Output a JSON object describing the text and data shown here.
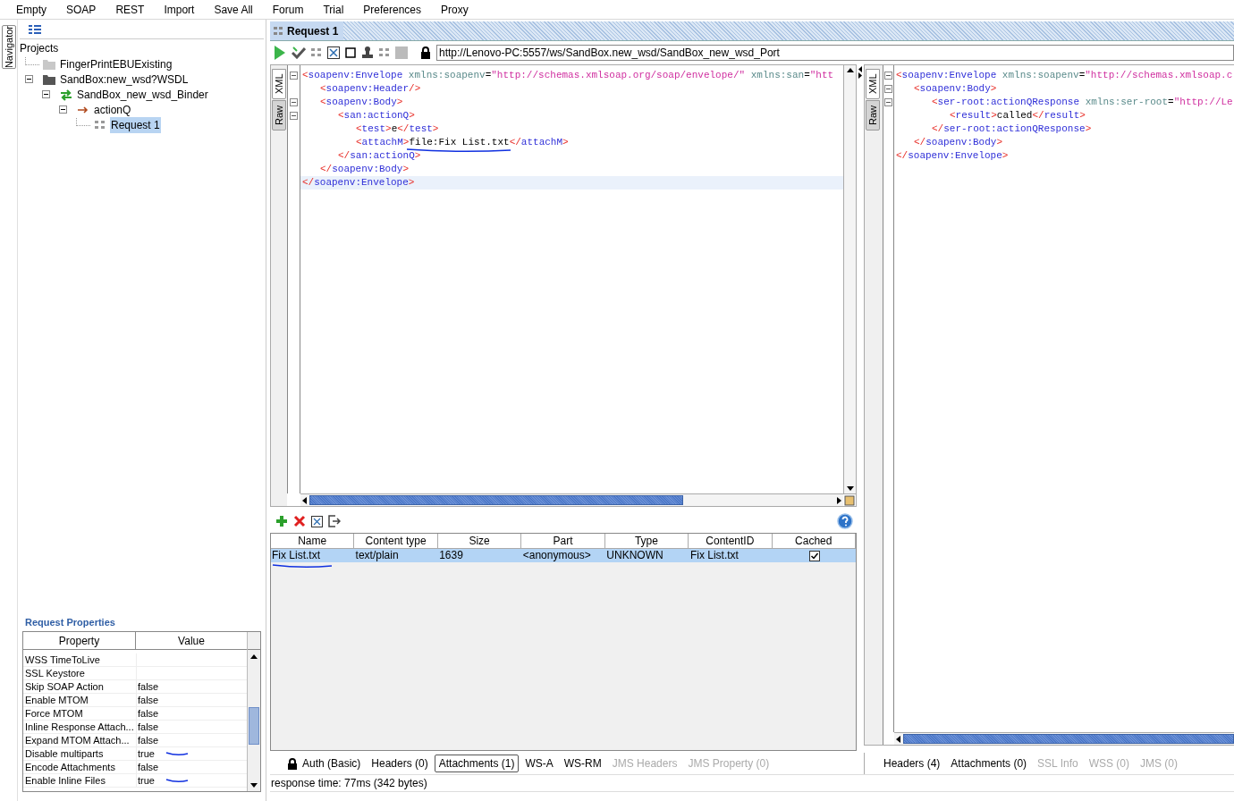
{
  "menu": [
    "Empty",
    "SOAP",
    "REST",
    "Import",
    "Save All",
    "Forum",
    "Trial",
    "Preferences",
    "Proxy"
  ],
  "navigator_tab": "Navigator",
  "tree": {
    "label": "Projects",
    "children": [
      {
        "label": "FingerPrintEBUExisting",
        "kind": "closed-project",
        "selected": false
      },
      {
        "label": "SandBox:new_wsd?WSDL",
        "kind": "project",
        "expanded": true,
        "selected": false,
        "children": [
          {
            "label": "SandBox_new_wsd_Binder",
            "kind": "interface",
            "expanded": true,
            "selected": false,
            "children": [
              {
                "label": "actionQ",
                "kind": "operation",
                "expanded": true,
                "selected": false,
                "children": [
                  {
                    "label": "Request 1",
                    "kind": "request",
                    "selected": true
                  }
                ]
              }
            ]
          }
        ]
      }
    ]
  },
  "request_properties": {
    "title": "Request Properties",
    "columns": [
      "Property",
      "Value"
    ],
    "rows": [
      {
        "property": "WSS TimeToLive",
        "pen_mark": false
      },
      {
        "property": "SSL Keystore",
        "pen_mark": false
      },
      {
        "property": "Skip SOAP Action",
        "value": "false",
        "pen_mark": false
      },
      {
        "property": "Enable MTOM",
        "value": "false",
        "pen_mark": false
      },
      {
        "property": "Force MTOM",
        "value": "false",
        "pen_mark": false
      },
      {
        "property": "Inline Response Attach...",
        "value": "false",
        "pen_mark": false
      },
      {
        "property": "Expand MTOM Attach...",
        "value": "false",
        "pen_mark": false
      },
      {
        "property": "Disable multiparts",
        "value": "true",
        "pen_mark": true
      },
      {
        "property": "Encode Attachments",
        "value": "false",
        "pen_mark": false
      },
      {
        "property": "Enable Inline Files",
        "value": "true",
        "pen_mark": true
      }
    ]
  },
  "request": {
    "title": "Request 1",
    "url": "http://Lenovo-PC:5557/ws/SandBox.new_wsd/SandBox_new_wsd_Port",
    "editor_tabs": [
      {
        "label": "XML",
        "selected": true
      },
      {
        "label": "Raw",
        "selected": false
      }
    ],
    "lines": [
      {
        "fold": true,
        "tokens": [
          {
            "kind": "punct",
            "text": "<"
          },
          {
            "kind": "tag",
            "text": "soapenv:Envelope"
          },
          {
            "kind": "attr",
            "text": " xmlns:soapenv"
          },
          {
            "kind": "text",
            "text": "="
          },
          {
            "kind": "value",
            "text": "\"http://schemas.xmlsoap.org/soap/envelope/\""
          },
          {
            "kind": "attr",
            "text": " xmlns:san"
          },
          {
            "kind": "text",
            "text": "="
          },
          {
            "kind": "value",
            "text": "\"htt"
          }
        ],
        "children": [
          {
            "fold": false,
            "tokens": [
              {
                "kind": "punct",
                "text": "<"
              },
              {
                "kind": "tag",
                "text": "soapenv:Header"
              },
              {
                "kind": "punct",
                "text": "/>"
              }
            ]
          },
          {
            "fold": true,
            "tokens": [
              {
                "kind": "punct",
                "text": "<"
              },
              {
                "kind": "tag",
                "text": "soapenv:Body"
              },
              {
                "kind": "punct",
                "text": ">"
              }
            ],
            "children": [
              {
                "fold": true,
                "tokens": [
                  {
                    "kind": "punct",
                    "text": "<"
                  },
                  {
                    "kind": "tag",
                    "text": "san:actionQ"
                  },
                  {
                    "kind": "punct",
                    "text": ">"
                  }
                ],
                "children": [
                  {
                    "fold": false,
                    "tokens": [
                      {
                        "kind": "punct",
                        "text": "<"
                      },
                      {
                        "kind": "tag",
                        "text": "test"
                      },
                      {
                        "kind": "punct",
                        "text": ">"
                      },
                      {
                        "kind": "text",
                        "text": "e"
                      },
                      {
                        "kind": "punct",
                        "text": "</"
                      },
                      {
                        "kind": "tag",
                        "text": "test"
                      },
                      {
                        "kind": "punct",
                        "text": ">"
                      }
                    ]
                  },
                  {
                    "fold": false,
                    "pen_mark": true,
                    "tokens": [
                      {
                        "kind": "punct",
                        "text": "<"
                      },
                      {
                        "kind": "tag",
                        "text": "attachM"
                      },
                      {
                        "kind": "punct",
                        "text": ">"
                      },
                      {
                        "kind": "text",
                        "text": "file:Fix List.txt"
                      },
                      {
                        "kind": "punct",
                        "text": "</"
                      },
                      {
                        "kind": "tag",
                        "text": "attachM"
                      },
                      {
                        "kind": "punct",
                        "text": ">"
                      }
                    ]
                  }
                ]
              },
              {
                "fold": false,
                "tokens": [
                  {
                    "kind": "punct",
                    "text": "</"
                  },
                  {
                    "kind": "tag",
                    "text": "san:actionQ"
                  },
                  {
                    "kind": "punct",
                    "text": ">"
                  }
                ]
              }
            ]
          },
          {
            "fold": false,
            "tokens": [
              {
                "kind": "punct",
                "text": "</"
              },
              {
                "kind": "tag",
                "text": "soapenv:Body"
              },
              {
                "kind": "punct",
                "text": ">"
              }
            ]
          }
        ]
      },
      {
        "fold": false,
        "current": true,
        "tokens": [
          {
            "kind": "punct",
            "text": "</"
          },
          {
            "kind": "tag",
            "text": "soapenv:Envelope"
          },
          {
            "kind": "punct",
            "text": ">"
          }
        ]
      }
    ]
  },
  "attachments": {
    "columns": [
      "Name",
      "Content type",
      "Size",
      "Part",
      "Type",
      "ContentID",
      "Cached"
    ],
    "rows": [
      {
        "selected": true,
        "cached": true,
        "pen_mark": true,
        "cells": [
          "Fix List.txt",
          "text/plain",
          "1639",
          "<anonymous>",
          "UNKNOWN",
          "Fix List.txt"
        ]
      }
    ]
  },
  "request_tabs": [
    {
      "label": "Auth (Basic)",
      "kind": "auth",
      "selected": false,
      "disabled": false
    },
    {
      "label": "Headers (0)",
      "selected": false,
      "disabled": false
    },
    {
      "label": "Attachments (1)",
      "selected": true,
      "disabled": false
    },
    {
      "label": "WS-A",
      "selected": false,
      "disabled": false
    },
    {
      "label": "WS-RM",
      "selected": false,
      "disabled": false
    },
    {
      "label": "JMS Headers",
      "selected": false,
      "disabled": true
    },
    {
      "label": "JMS Property (0)",
      "selected": false,
      "disabled": true
    }
  ],
  "response": {
    "editor_tabs": [
      {
        "label": "XML",
        "selected": true
      },
      {
        "label": "Raw",
        "selected": false
      }
    ],
    "lines": [
      {
        "fold": true,
        "tokens": [
          {
            "kind": "punct",
            "text": "<"
          },
          {
            "kind": "tag",
            "text": "soapenv:Envelope"
          },
          {
            "kind": "attr",
            "text": " xmlns:soapenv"
          },
          {
            "kind": "text",
            "text": "="
          },
          {
            "kind": "value",
            "text": "\"http://schemas.xmlsoap.c"
          }
        ],
        "children": [
          {
            "fold": true,
            "tokens": [
              {
                "kind": "punct",
                "text": "<"
              },
              {
                "kind": "tag",
                "text": "soapenv:Body"
              },
              {
                "kind": "punct",
                "text": ">"
              }
            ],
            "children": [
              {
                "fold": true,
                "tokens": [
                  {
                    "kind": "punct",
                    "text": "<"
                  },
                  {
                    "kind": "tag",
                    "text": "ser-root:actionQResponse"
                  },
                  {
                    "kind": "attr",
                    "text": " xmlns:ser-root"
                  },
                  {
                    "kind": "text",
                    "text": "="
                  },
                  {
                    "kind": "value",
                    "text": "\"http://Le"
                  }
                ],
                "children": [
                  {
                    "fold": false,
                    "tokens": [
                      {
                        "kind": "punct",
                        "text": "<"
                      },
                      {
                        "kind": "tag",
                        "text": "result"
                      },
                      {
                        "kind": "punct",
                        "text": ">"
                      },
                      {
                        "kind": "text",
                        "text": "called"
                      },
                      {
                        "kind": "punct",
                        "text": "</"
                      },
                      {
                        "kind": "tag",
                        "text": "result"
                      },
                      {
                        "kind": "punct",
                        "text": ">"
                      }
                    ]
                  }
                ]
              },
              {
                "fold": false,
                "tokens": [
                  {
                    "kind": "punct",
                    "text": "</"
                  },
                  {
                    "kind": "tag",
                    "text": "ser-root:actionQResponse"
                  },
                  {
                    "kind": "punct",
                    "text": ">"
                  }
                ]
              }
            ]
          },
          {
            "fold": false,
            "tokens": [
              {
                "kind": "punct",
                "text": "</"
              },
              {
                "kind": "tag",
                "text": "soapenv:Body"
              },
              {
                "kind": "punct",
                "text": ">"
              }
            ]
          }
        ]
      },
      {
        "fold": false,
        "tokens": [
          {
            "kind": "punct",
            "text": "</"
          },
          {
            "kind": "tag",
            "text": "soapenv:Envelope"
          },
          {
            "kind": "punct",
            "text": ">"
          }
        ]
      }
    ],
    "tabs": [
      {
        "label": "Headers (4)",
        "selected": false,
        "disabled": false
      },
      {
        "label": "Attachments (0)",
        "selected": false,
        "disabled": false
      },
      {
        "label": "SSL Info",
        "selected": false,
        "disabled": true
      },
      {
        "label": "WSS (0)",
        "selected": false,
        "disabled": true
      },
      {
        "label": "JMS (0)",
        "selected": false,
        "disabled": true
      }
    ]
  },
  "status_bar": "response time: 77ms (342 bytes)"
}
